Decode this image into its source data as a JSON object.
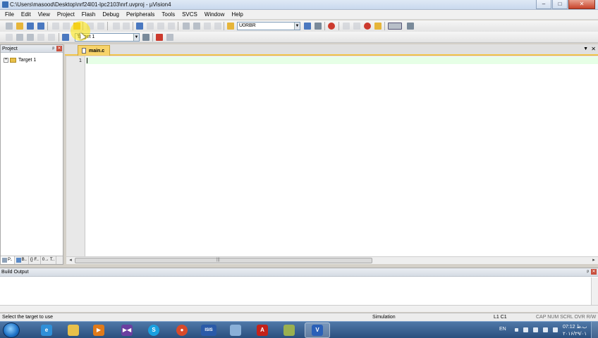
{
  "window": {
    "title": "C:\\Users\\masood\\Desktop\\nrf24l01-lpc2103\\nrf.uvproj - µVision4",
    "minimize": "–",
    "maximize": "□",
    "close": "✕"
  },
  "menubar": {
    "items": [
      "File",
      "Edit",
      "View",
      "Project",
      "Flash",
      "Debug",
      "Peripherals",
      "Tools",
      "SVCS",
      "Window",
      "Help"
    ]
  },
  "toolbar": {
    "find_combo": "U0RBR",
    "target_combo": "Target 1",
    "combo_arrow": "▼"
  },
  "project_panel": {
    "title": "Project",
    "pin": "ᵖ",
    "close": "✕",
    "tree": [
      {
        "label": "Target 1",
        "expander": "+"
      }
    ],
    "tabs": [
      "P..",
      "B..",
      "{} F..",
      "0→ T.."
    ]
  },
  "editor": {
    "tab": "main.c",
    "tab_menu": "▼",
    "tab_close": "✕",
    "line_numbers": [
      "1"
    ],
    "scroll_left": "◂",
    "scroll_right": "▸",
    "scroll_grip": "|||"
  },
  "build_output": {
    "title": "Build Output",
    "pin": "ᵖ",
    "close": "✕"
  },
  "statusbar": {
    "message": "Select the target to use",
    "mode": "Simulation",
    "position": "L1 C1",
    "indicators": "CAP  NUM  SCRL  OVR  R/W"
  },
  "taskbar": {
    "apps": [
      {
        "icon": "ie-icon",
        "glyph": "e",
        "color": "#2f8fd8"
      },
      {
        "icon": "explorer-icon",
        "glyph": "",
        "color": "#e8c04a"
      },
      {
        "icon": "media-player-icon",
        "glyph": "▶",
        "color": "#e07a1a"
      },
      {
        "icon": "visual-studio-icon",
        "glyph": "▶◀",
        "color": "#6a3fa0"
      },
      {
        "icon": "skype-icon",
        "glyph": "S",
        "color": "#1aa0e0"
      },
      {
        "icon": "chrome-icon",
        "glyph": "●",
        "color": "#d84a2a"
      },
      {
        "icon": "isis-icon",
        "glyph": "ISIS",
        "color": "#2a5aa8"
      },
      {
        "icon": "notes-icon",
        "glyph": "",
        "color": "#8ab0d8"
      },
      {
        "icon": "acrobat-icon",
        "glyph": "A",
        "color": "#c4221a"
      },
      {
        "icon": "winrar-icon",
        "glyph": "",
        "color": "#9ab050"
      },
      {
        "icon": "keil-icon",
        "glyph": "V",
        "color": "#2a60b8"
      }
    ],
    "tray": {
      "language": "EN",
      "time": "07:12 ب.ظ",
      "date": "۲۰۱۶/۲۹/۰۱"
    }
  }
}
